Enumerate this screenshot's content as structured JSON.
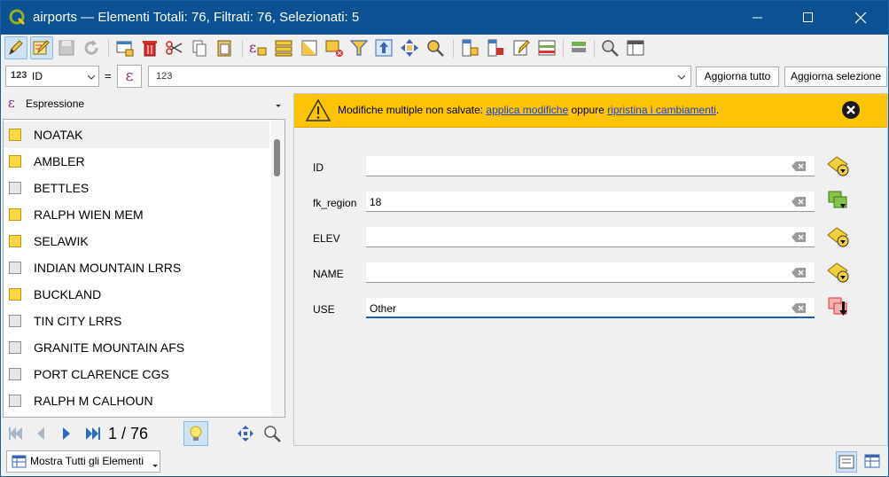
{
  "window": {
    "title": "airports — Elementi Totali: 76, Filtrati: 76, Selezionati: 5",
    "controls": [
      "minimize",
      "maximize",
      "close"
    ]
  },
  "toolbar": {
    "buttons": [
      "toggle-editing-icon",
      "multi-edit-icon",
      "save-edits-icon",
      "reload-icon",
      "add-feature-icon",
      "delete-feature-icon",
      "cut-icon",
      "copy-icon",
      "paste-icon",
      "select-by-expression-icon",
      "select-all-icon",
      "invert-selection-icon",
      "deselect-all-icon",
      "filter-icon",
      "move-selection-to-top-icon",
      "pan-to-selected-icon",
      "zoom-to-selected-icon",
      "new-field-icon",
      "delete-field-icon",
      "field-calculator-icon",
      "conditional-formatting-icon",
      "actions-icon",
      "dock-icon",
      "organize-columns-icon"
    ]
  },
  "filter": {
    "field_type": "123",
    "field_name": "ID",
    "operator": "=",
    "value_type": "123",
    "value": "",
    "update_all_label": "Aggiorna tutto",
    "update_selected_label": "Aggiorna selezione"
  },
  "left": {
    "expression_label": "Espressione",
    "items": [
      {
        "name": "NOATAK",
        "selected": true
      },
      {
        "name": "AMBLER",
        "selected": true
      },
      {
        "name": "BETTLES",
        "selected": false
      },
      {
        "name": "RALPH WIEN MEM",
        "selected": true
      },
      {
        "name": "SELAWIK",
        "selected": true
      },
      {
        "name": "INDIAN MOUNTAIN LRRS",
        "selected": false
      },
      {
        "name": "BUCKLAND",
        "selected": true
      },
      {
        "name": "TIN CITY LRRS",
        "selected": false
      },
      {
        "name": "GRANITE MOUNTAIN AFS",
        "selected": false
      },
      {
        "name": "PORT CLARENCE CGS",
        "selected": false
      },
      {
        "name": "RALPH M CALHOUN",
        "selected": false
      }
    ],
    "position": "1 / 76",
    "show_all_label": "Mostra Tutti gli Elementi"
  },
  "warning": {
    "prefix": "Modifiche multiple non salvate: ",
    "apply_link": "applica modifiche",
    "middle": " oppure ",
    "reset_link": "ripristina i cambiamenti",
    "suffix": "."
  },
  "form": {
    "fields": [
      {
        "label": "ID",
        "value": "",
        "state": "mixed"
      },
      {
        "label": "fk_region",
        "value": "18",
        "state": "same"
      },
      {
        "label": "ELEV",
        "value": "",
        "state": "mixed"
      },
      {
        "label": "NAME",
        "value": "",
        "state": "mixed"
      },
      {
        "label": "USE",
        "value": "Other",
        "state": "changed"
      }
    ]
  },
  "colors": {
    "titlebar": "#0b5193",
    "warning_bg": "#fdc406",
    "selected_checkbox": "#ffd83d",
    "link": "#1c3fd6"
  }
}
